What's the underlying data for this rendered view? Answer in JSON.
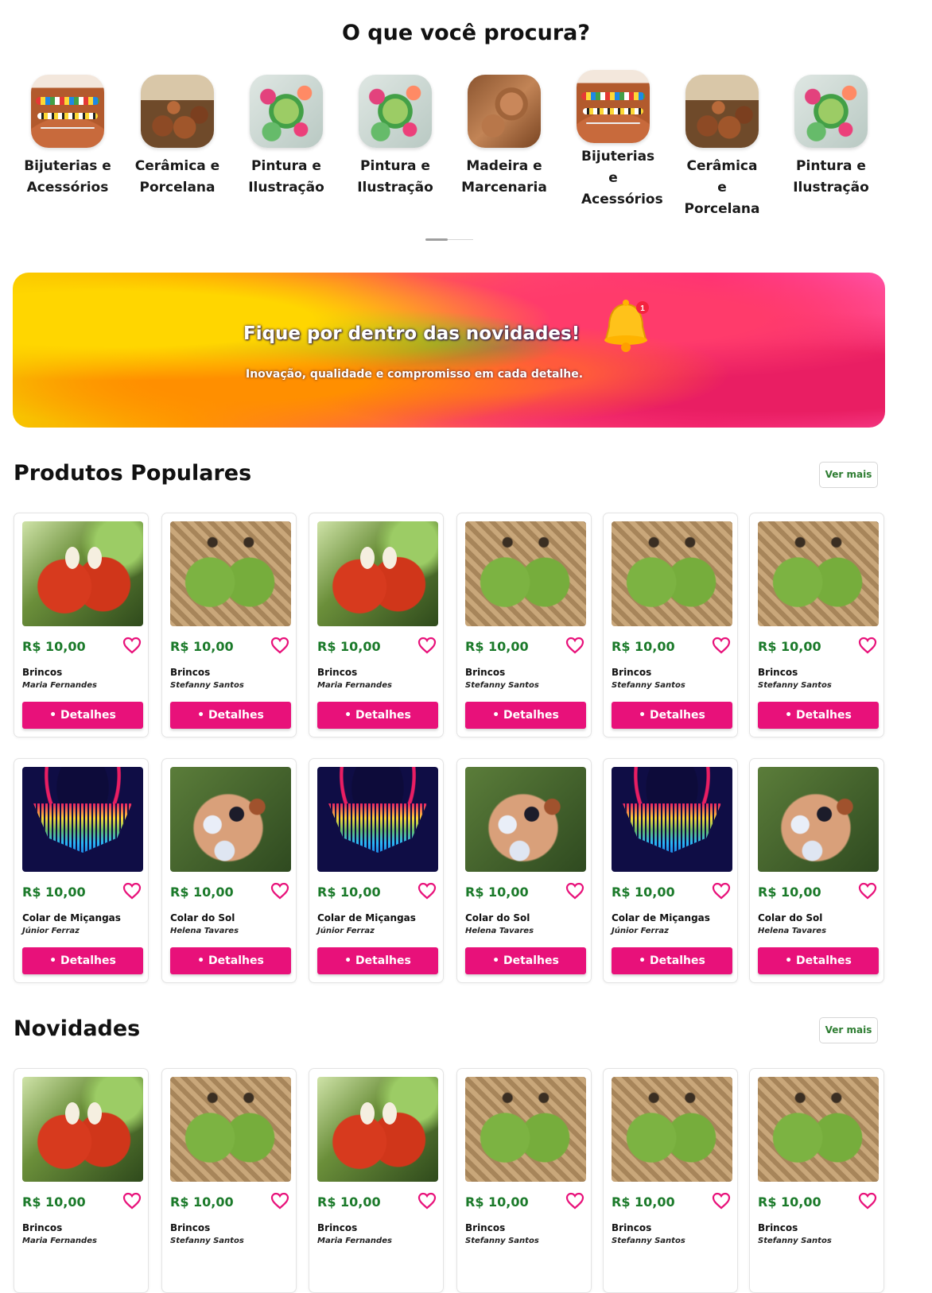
{
  "categories_section": {
    "title": "O que você procura?",
    "items": [
      {
        "label": "Bijuterias e Acessórios",
        "image": "bijuteria"
      },
      {
        "label": "Cerâmica e Porcelana",
        "image": "ceramica"
      },
      {
        "label": "Pintura e Ilustração",
        "image": "pintura"
      },
      {
        "label": "Pintura e Ilustração",
        "image": "pintura"
      },
      {
        "label": "Madeira e Marcenaria",
        "image": "madeira"
      },
      {
        "label": "Bijuterias e Acessórios",
        "image": "bijuteria"
      },
      {
        "label": "Cerâmica e Porcelana",
        "image": "ceramica"
      },
      {
        "label": "Pintura e Ilustração",
        "image": "pintura"
      }
    ]
  },
  "banner": {
    "title": "Fique por dentro das novidades!",
    "subtitle": "Inovação, qualidade e compromisso em cada detalhe.",
    "icon": "bell-icon",
    "badge": "1"
  },
  "popular": {
    "title": "Produtos Populares",
    "see_more": "Ver mais",
    "products": [
      {
        "price": "R$ 10,00",
        "name": "Brincos",
        "seller": "Maria Fernandes",
        "image": "red",
        "button": "• Detalhes"
      },
      {
        "price": "R$ 10,00",
        "name": "Brincos",
        "seller": "Stefanny Santos",
        "image": "green",
        "button": "• Detalhes"
      },
      {
        "price": "R$ 10,00",
        "name": "Brincos",
        "seller": "Maria Fernandes",
        "image": "red",
        "button": "• Detalhes"
      },
      {
        "price": "R$ 10,00",
        "name": "Brincos",
        "seller": "Stefanny Santos",
        "image": "green",
        "button": "• Detalhes"
      },
      {
        "price": "R$ 10,00",
        "name": "Brincos",
        "seller": "Stefanny Santos",
        "image": "green",
        "button": "• Detalhes"
      },
      {
        "price": "R$ 10,00",
        "name": "Brincos",
        "seller": "Stefanny Santos",
        "image": "green",
        "button": "• Detalhes"
      },
      {
        "price": "R$ 10,00",
        "name": "Colar de Miçangas",
        "seller": "Júnior Ferraz",
        "image": "colar",
        "button": "• Detalhes"
      },
      {
        "price": "R$ 10,00",
        "name": "Colar do Sol",
        "seller": "Helena Tavares",
        "image": "sol",
        "button": "• Detalhes"
      },
      {
        "price": "R$ 10,00",
        "name": "Colar de Miçangas",
        "seller": "Júnior Ferraz",
        "image": "colar",
        "button": "• Detalhes"
      },
      {
        "price": "R$ 10,00",
        "name": "Colar do Sol",
        "seller": "Helena Tavares",
        "image": "sol",
        "button": "• Detalhes"
      },
      {
        "price": "R$ 10,00",
        "name": "Colar de Miçangas",
        "seller": "Júnior Ferraz",
        "image": "colar",
        "button": "• Detalhes"
      },
      {
        "price": "R$ 10,00",
        "name": "Colar do Sol",
        "seller": "Helena Tavares",
        "image": "sol",
        "button": "• Detalhes"
      }
    ]
  },
  "novidades": {
    "title": "Novidades",
    "see_more": "Ver mais",
    "products": [
      {
        "price": "R$ 10,00",
        "name": "Brincos",
        "seller": "Maria Fernandes",
        "image": "red"
      },
      {
        "price": "R$ 10,00",
        "name": "Brincos",
        "seller": "Stefanny Santos",
        "image": "green"
      },
      {
        "price": "R$ 10,00",
        "name": "Brincos",
        "seller": "Maria Fernandes",
        "image": "red"
      },
      {
        "price": "R$ 10,00",
        "name": "Brincos",
        "seller": "Stefanny Santos",
        "image": "green"
      },
      {
        "price": "R$ 10,00",
        "name": "Brincos",
        "seller": "Stefanny Santos",
        "image": "green"
      },
      {
        "price": "R$ 10,00",
        "name": "Brincos",
        "seller": "Stefanny Santos",
        "image": "green"
      }
    ]
  },
  "colors": {
    "accent_pink": "#e8117a",
    "price_green": "#1b7a2a",
    "heart_pink": "#e8117a"
  }
}
